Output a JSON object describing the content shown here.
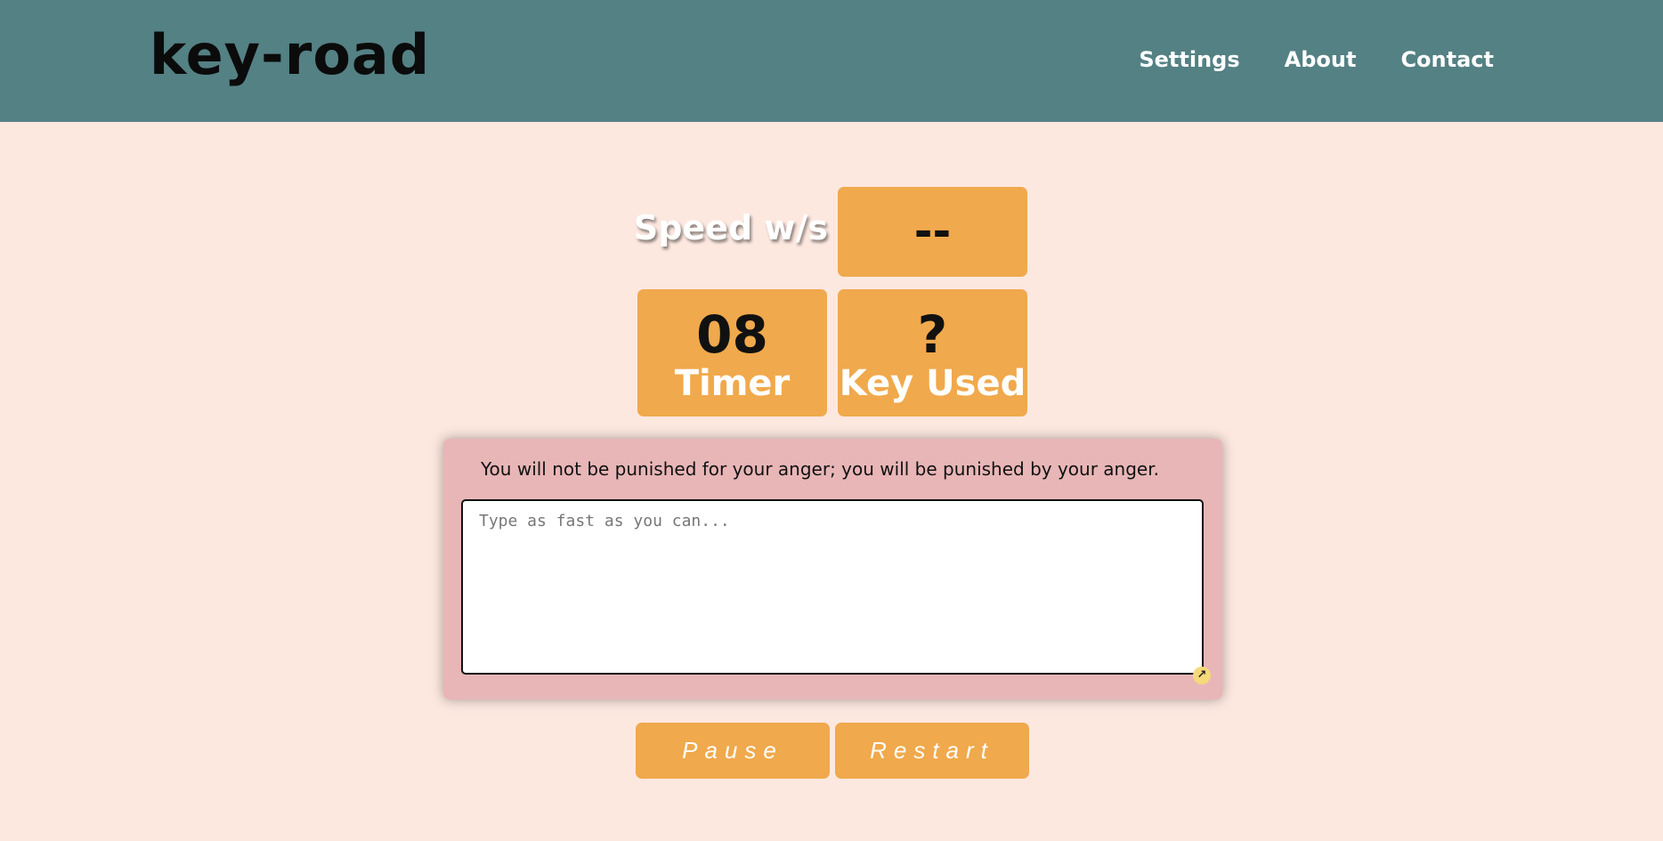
{
  "header": {
    "logo": "key-road",
    "nav": [
      "Settings",
      "About",
      "Contact"
    ]
  },
  "stats": {
    "speed_label": "Speed w/s",
    "speed_value": "--",
    "timer_value": "08",
    "timer_label": "Timer",
    "key_value": "?",
    "key_label": "Key Used"
  },
  "typing": {
    "quote": "You will not be punished for your anger; you will be punished by your anger.",
    "placeholder": "Type as fast as you can..."
  },
  "controls": {
    "pause_label": "Pause",
    "restart_label": "Restart"
  },
  "colors": {
    "header_bg": "#548184",
    "page_bg": "#fde8e0",
    "stat_box": "#f0a94c",
    "panel_bg": "#e8b6b7"
  }
}
